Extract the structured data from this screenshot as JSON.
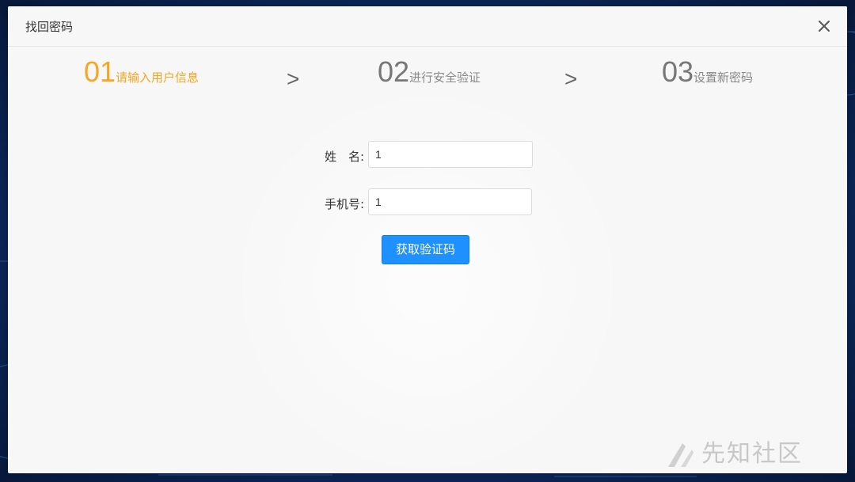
{
  "dialog": {
    "title": "找回密码",
    "close_icon": "close-icon"
  },
  "steps": [
    {
      "number": "01",
      "label": "请输入用户信息",
      "state": "active"
    },
    {
      "number": "02",
      "label": "进行安全验证",
      "state": "inactive"
    },
    {
      "number": "03",
      "label": "设置新密码",
      "state": "inactive"
    }
  ],
  "step_separator": ">",
  "form": {
    "name_label": "姓　名:",
    "name_value": "1",
    "phone_label": "手机号:",
    "phone_value": "1",
    "submit_label": "获取验证码"
  },
  "watermark": "先知社区",
  "colors": {
    "active_step": "#f5a623",
    "primary_button": "#1e90ff",
    "backdrop": "#0c2a5e"
  }
}
